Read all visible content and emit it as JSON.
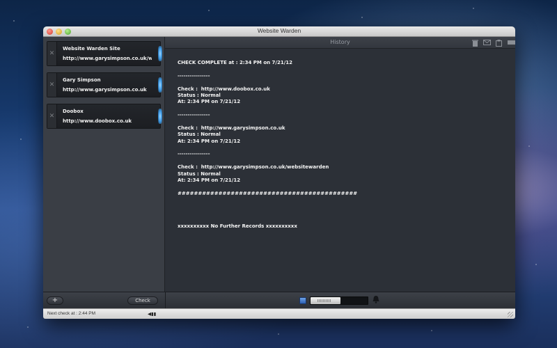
{
  "window": {
    "title": "Website Warden"
  },
  "sidebar": {
    "items": [
      {
        "name": "Website Warden Site",
        "url": "http://www.garysimpson.co.uk/wel"
      },
      {
        "name": "Gary Simpson",
        "url": "http://www.garysimpson.co.uk"
      },
      {
        "name": "Doobox",
        "url": "http://www.doobox.co.uk"
      }
    ],
    "remove_glyph": "✕",
    "add_label": "+",
    "check_label": "Check"
  },
  "history": {
    "title": "History",
    "icons": [
      "trash-icon",
      "mail-icon",
      "clipboard-icon",
      "drive-icon"
    ],
    "lines": [
      "CHECK COMPLETE at : 2:34 PM on 7/21/12",
      "",
      "----------------",
      "",
      "Check :  http://www.doobox.co.uk",
      "Status : Normal",
      "At: 2:34 PM on 7/21/12",
      "",
      "----------------",
      "",
      "Check :  http://www.garysimpson.co.uk",
      "Status : Normal",
      "At: 2:34 PM on 7/21/12",
      "",
      "----------------",
      "",
      "Check :  http://www.garysimpson.co.uk/websitewarden",
      "Status : Normal",
      "At: 2:34 PM on 7/21/12",
      "",
      "############################################",
      "",
      "",
      "",
      "",
      "xxxxxxxxxx No Further Records xxxxxxxxxx"
    ]
  },
  "toolbar": {
    "slider_value": 0.53
  },
  "status": {
    "next_check": "Next check at : 2:44 PM",
    "controls": "◀▮▮"
  },
  "colors": {
    "accent_glow": "#3b9ae8",
    "panel": "#2c3037",
    "sidebar": "#3a3e45"
  }
}
